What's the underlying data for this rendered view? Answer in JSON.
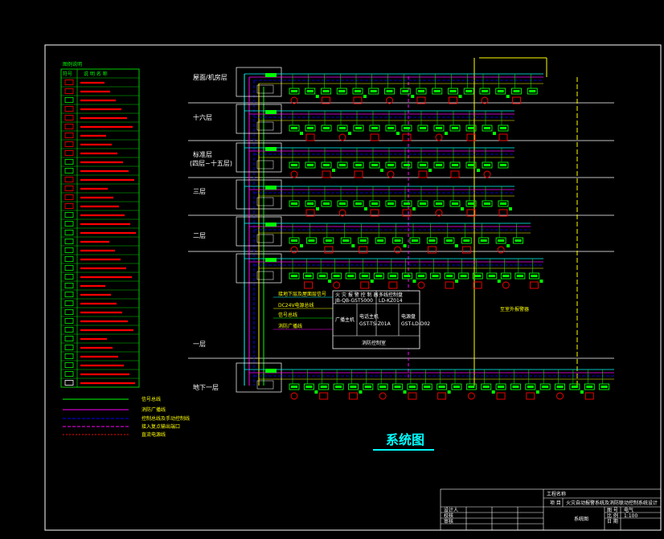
{
  "legend": {
    "title": "图例说明",
    "header": [
      "符号",
      "说 明 名 称"
    ]
  },
  "floors": [
    "屋面/机房层",
    "十六层",
    "标准层",
    "(四层~十五层)",
    "三层",
    "二层",
    "一层",
    "地下一层"
  ],
  "panel": {
    "r1a": "火 灾 报 警 控 制 器",
    "r1b": "JB-QB-GST5000",
    "r1c": "多线控制盘",
    "r1d": "LD-KZ014",
    "r2a": "广播主机",
    "r2b": "电话主机",
    "r2c": "GST-TS-Z01A",
    "r2d": "电源盘",
    "r2e": "GST-LD-D02",
    "bottom": "消防控制室"
  },
  "bus_labels": [
    "接地下层及屋面层信号",
    "DC24V电源总线",
    "信号总线",
    "消防广播线"
  ],
  "right_note": "至室外报警器",
  "line_legend": [
    "信号总线",
    "消防广播线",
    "控制总线及手动控制线",
    "接入复点输出端口",
    "直流电源线"
  ],
  "main_title": "系统图",
  "title_block": {
    "project": "工程名称",
    "item": "项 目",
    "item_value": "火灾自动报警系统及消防联动控制系统设计",
    "design": "设计人",
    "check": "校核",
    "review": "审核",
    "draw": "系统图",
    "no": "图 号",
    "no_value": "电气",
    "scale": "比 例",
    "scale_value": "1:100",
    "date": "日 期"
  },
  "colors": {
    "background": "#000000",
    "bus_green": "#00ff00",
    "bus_cyan": "#00ffff",
    "bus_magenta": "#ff00ff",
    "bus_yellow": "#ffff00",
    "symbol_red": "#ff0000",
    "text_white": "#ffffff"
  }
}
